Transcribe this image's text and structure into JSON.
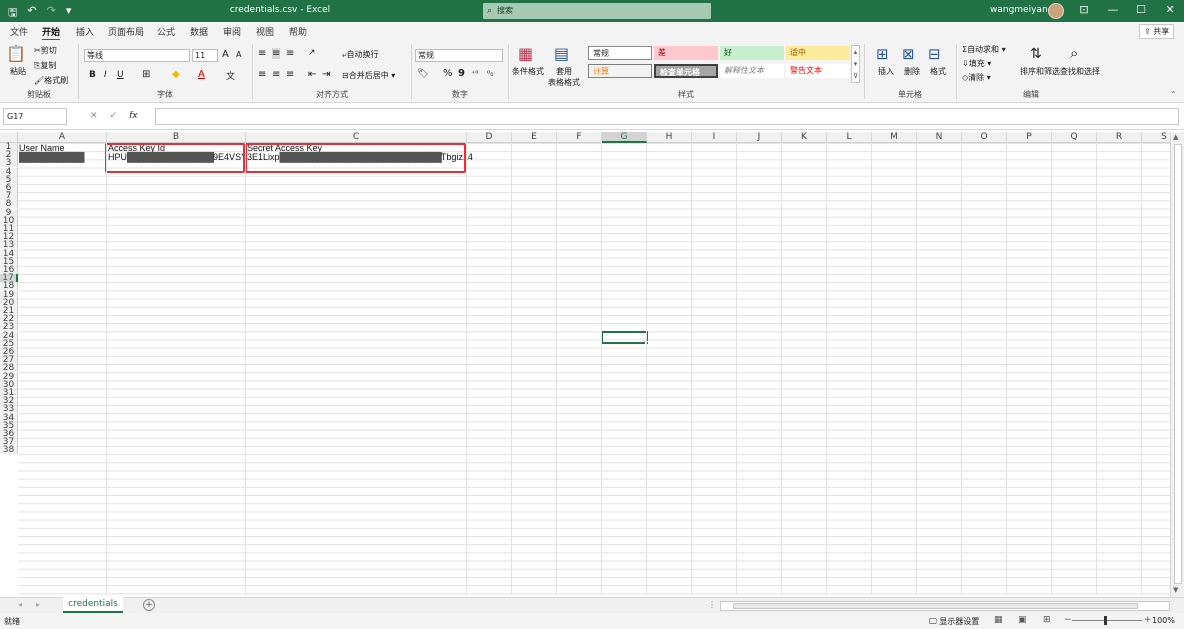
{
  "window": {
    "title": "credentials.csv  -  Excel",
    "search_placeholder": "搜索",
    "user_name": "wangmeiyang",
    "btn_minimize": "—",
    "btn_restore": "☐",
    "btn_close": "✕",
    "btn_ribbon_display": "⊡"
  },
  "qat": {
    "save": "🖫",
    "undo": "↶",
    "redo": "↷",
    "more": "▾"
  },
  "ribbon_tabs": [
    "文件",
    "开始",
    "插入",
    "页面布局",
    "公式",
    "数据",
    "审阅",
    "视图",
    "帮助"
  ],
  "active_tab": "开始",
  "share_label": "共享",
  "clipboard": {
    "paste": "粘贴",
    "cut": "剪切",
    "copy": "复制",
    "format_painter": "格式刷",
    "group": "剪贴板"
  },
  "font": {
    "name": "等线",
    "size": "11",
    "bold": "B",
    "italic": "I",
    "underline": "U",
    "grow": "A",
    "shrink": "A",
    "group": "字体"
  },
  "alignment": {
    "wrap": "自动换行",
    "merge": "合并后居中",
    "group": "对齐方式"
  },
  "number": {
    "format": "常规",
    "percent": "%",
    "comma": "9",
    "group": "数字"
  },
  "styles": {
    "conditional": "条件格式",
    "table": "套用\n表格格式",
    "cells": [
      {
        "label": "常规",
        "bg": "#ffffff",
        "color": "#222222"
      },
      {
        "label": "差",
        "bg": "#ffc7ce",
        "color": "#9c0006"
      },
      {
        "label": "好",
        "bg": "#c6efce",
        "color": "#006100"
      },
      {
        "label": "适中",
        "bg": "#ffeb9c",
        "color": "#9c5700"
      },
      {
        "label": "计算",
        "bg": "#f2f2f2",
        "color": "#fa7d00"
      },
      {
        "label": "检查单元格",
        "bg": "#a5a5a5",
        "color": "#ffffff"
      },
      {
        "label": "解释性文本",
        "bg": "#ffffff",
        "color": "#7f7f7f"
      },
      {
        "label": "警告文本",
        "bg": "#ffffff",
        "color": "#ff0000"
      }
    ],
    "group": "样式"
  },
  "cells_group": {
    "insert": "插入",
    "delete": "删除",
    "format": "格式",
    "group": "单元格"
  },
  "editing": {
    "autosum": "自动求和",
    "fill": "填充",
    "clear": "清除",
    "sort": "排序和筛选",
    "find": "查找和选择",
    "group": "编辑"
  },
  "formula_bar": {
    "name_box": "G17",
    "cancel": "✕",
    "enter": "✓",
    "fx": "fx",
    "value": ""
  },
  "columns": [
    "A",
    "B",
    "C",
    "D",
    "E",
    "F",
    "G",
    "H",
    "I",
    "J",
    "K",
    "L",
    "M",
    "N",
    "O",
    "P",
    "Q",
    "R",
    "S"
  ],
  "rows": [
    "1",
    "2",
    "3",
    "4",
    "5",
    "6",
    "7",
    "8",
    "9",
    "10",
    "11",
    "12",
    "13",
    "14",
    "15",
    "16",
    "17",
    "18",
    "19",
    "20",
    "21",
    "22",
    "23",
    "24",
    "25",
    "26",
    "27",
    "28",
    "29",
    "30",
    "31",
    "32",
    "33",
    "34",
    "35",
    "36",
    "37",
    "38"
  ],
  "selected_cell": "G17",
  "sheet_cells": {
    "A1": "User Name",
    "B1": "Access Key Id",
    "C1": "Secret Access Key",
    "A2_mask": "████████████",
    "B2_prefix": "HPU",
    "B2_mask": "████████████████",
    "B2_suffix": "9E4VSY",
    "C2_prefix": "3E1Lixp",
    "C2_mask": "██████████████████████████████",
    "C2_suffix": "Tbgiz14"
  },
  "sheet_tabs": [
    "credentials"
  ],
  "add_sheet": "+",
  "status": {
    "ready": "就绪",
    "display_settings": "显示器设置",
    "zoom": "100%"
  },
  "colors": {
    "excel_green": "#217346",
    "highlight_red": "#e5303b"
  }
}
